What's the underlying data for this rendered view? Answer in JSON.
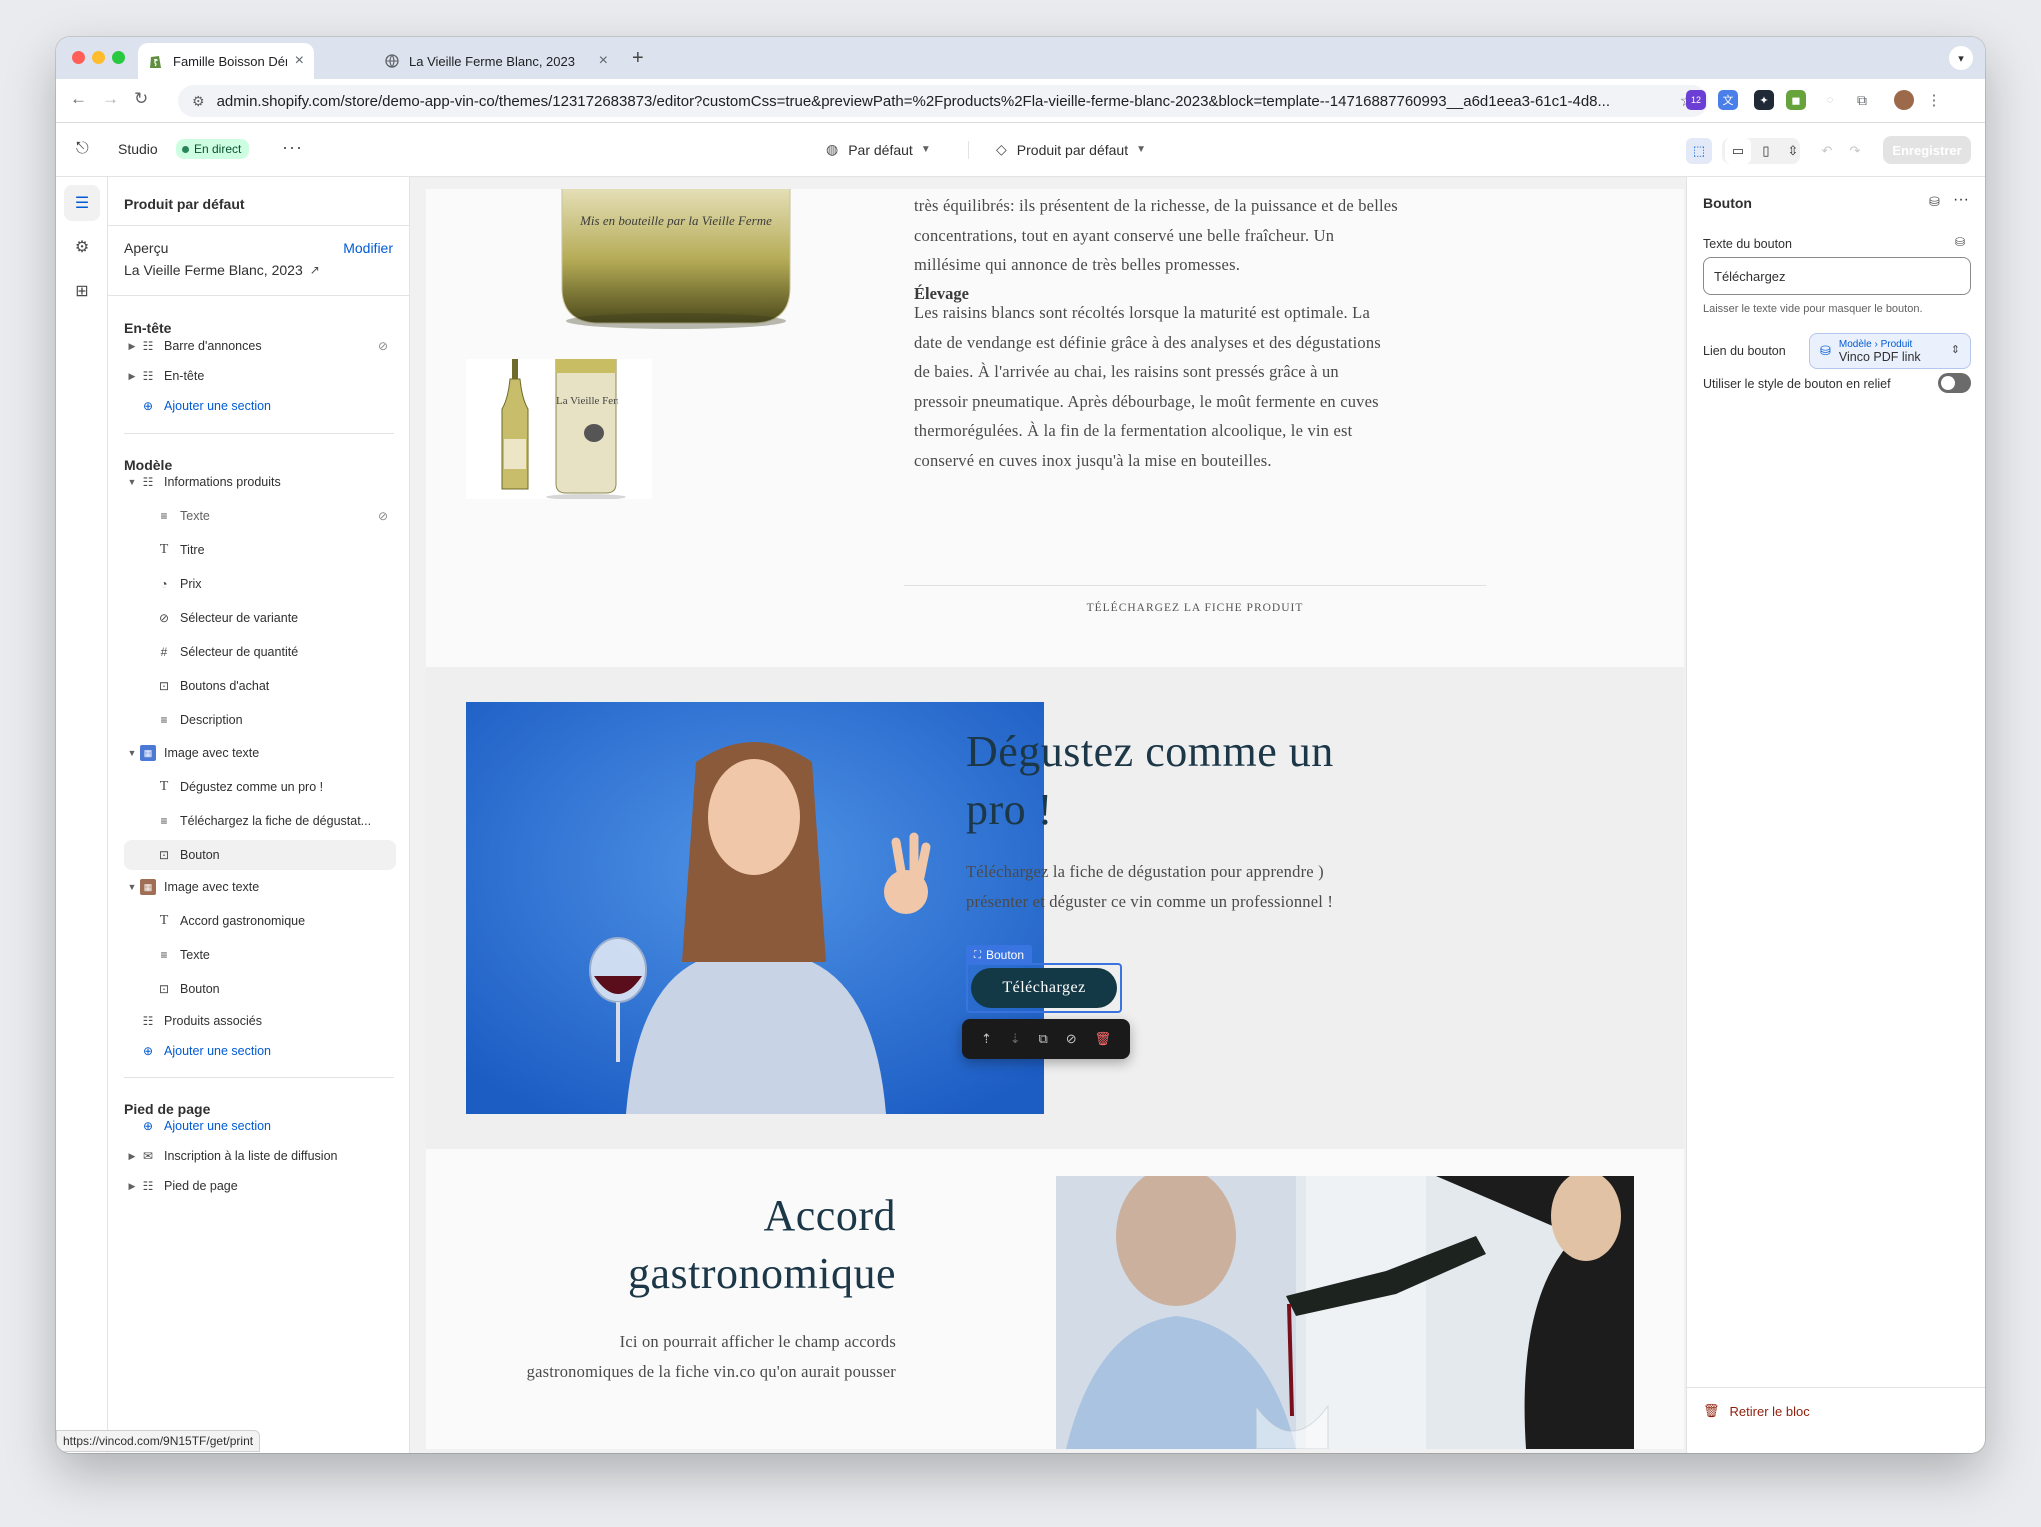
{
  "browser": {
    "tabs": [
      {
        "title": "Famille Boisson Démo - bouti",
        "close": "×"
      },
      {
        "title": "La Vieille Ferme Blanc, 2023",
        "close": "×"
      }
    ],
    "new_tab": "+",
    "url": "admin.shopify.com/store/demo-app-vin-co/themes/123172683873/editor?customCss=true&previewPath=%2Fproducts%2Fla-vieille-ferme-blanc-2023&block=template--14716887760993__a6d1eea3-61c1-4d8...",
    "ext_badge": "12",
    "status_url": "https://vincod.com/9N15TF/get/print"
  },
  "topbar": {
    "app_name": "Studio",
    "live_badge": "En direct",
    "theme_select": "Par défaut",
    "template_select": "Produit par défaut",
    "save_label": "Enregistrer"
  },
  "sidebar": {
    "title": "Produit par défaut",
    "preview_label": "Aperçu",
    "preview_edit": "Modifier",
    "preview_value": "La Vieille Ferme Blanc, 2023",
    "header_group": "En-tête",
    "header_items": [
      "Barre d'annonces",
      "En-tête"
    ],
    "add_section": "Ajouter une section",
    "template_group": "Modèle",
    "info_section": "Informations produits",
    "info_blocks": [
      "Texte",
      "Titre",
      "Prix",
      "Sélecteur de variante",
      "Sélecteur de quantité",
      "Boutons d'achat",
      "Description"
    ],
    "iwt1_section": "Image avec texte",
    "iwt1_blocks": [
      "Dégustez comme un pro !",
      "Téléchargez la fiche de dégustat...",
      "Bouton"
    ],
    "iwt2_section": "Image avec texte",
    "iwt2_blocks": [
      "Accord gastronomique",
      "Texte",
      "Bouton"
    ],
    "related_section": "Produits associés",
    "footer_group": "Pied de page",
    "footer_items": [
      "Inscription à la liste de diffusion",
      "Pied de page"
    ]
  },
  "preview": {
    "bottle_label": "Mis en bouteille par la Vieille Ferme",
    "thumb_label": "La Vieille Ferme",
    "desc_lines": [
      "très équilibrés: ils présentent de la richesse, de la puissance et de belles",
      "concentrations, tout en ayant conservé une belle fraîcheur. Un",
      "millésime qui annonce de très belles promesses."
    ],
    "elevage_title": "Élevage",
    "elevage_lines": [
      "Les raisins blancs sont récoltés lorsque la maturité est optimale. La",
      "date de vendange est définie grâce à des analyses et des dégustations",
      "de baies. À l'arrivée au chai, les raisins sont pressés grâce à un",
      "pressoir pneumatique. Après débourbage, le moût fermente en cuves",
      "thermorégulées. À la fin de la fermentation alcoolique, le vin est",
      "conservé en cuves inox jusqu'à la mise en bouteilles."
    ],
    "download_link": "TÉLÉCHARGEZ LA FICHE PRODUIT",
    "sec2_heading_lines": [
      "Dégustez comme un",
      "pro !"
    ],
    "sec2_text_lines": [
      "Téléchargez la fiche de dégustation pour apprendre )",
      "présenter et déguster ce vin comme un professionnel !"
    ],
    "block_tag": "Bouton",
    "sec2_button": "Téléchargez",
    "sec3_heading_lines": [
      "Accord",
      "gastronomique"
    ],
    "sec3_text_lines": [
      "Ici on pourrait afficher le champ accords",
      "gastronomiques de la fiche vin.co qu'on aurait pousser"
    ]
  },
  "settings": {
    "title": "Bouton",
    "text_label": "Texte du bouton",
    "text_value": "Téléchargez",
    "text_help": "Laisser le texte vide pour masquer le bouton.",
    "link_label": "Lien du bouton",
    "link_source": "Modèle › Produit",
    "link_value": "Vinco PDF link",
    "outline_label": "Utiliser le style de bouton en relief",
    "outline_value": false,
    "remove_label": "Retirer le bloc"
  },
  "colors": {
    "accent": "#005bd3",
    "heading": "#1c3747",
    "live": "#cdfee1",
    "danger": "#8e1f0b",
    "button": "#123945"
  }
}
